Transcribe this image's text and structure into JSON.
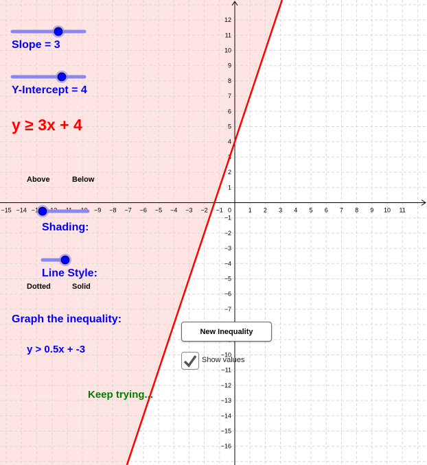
{
  "graph": {
    "x_range": [
      -15,
      11
    ],
    "y_range": [
      -16,
      12
    ],
    "line": {
      "slope": 3,
      "intercept": 4,
      "shade": "above",
      "style": "solid"
    },
    "colors": {
      "line": "#ff0000",
      "shade": "#ffe4e4",
      "grid": "#d8d8d8",
      "slider": "#0000ff",
      "feedback": "#008000"
    }
  },
  "controls": {
    "slope_label": "Slope = 3",
    "slope_value": 3,
    "intercept_label": "Y-Intercept = 4",
    "intercept_value": 4,
    "inequality": "y ≥ 3x + 4",
    "above_label": "Above",
    "below_label": "Below",
    "shading_label": "Shading:",
    "line_style_label": "Line Style:",
    "dotted_label": "Dotted",
    "solid_label": "Solid",
    "task_label": "Graph the inequality:",
    "target_inequality": "y > 0.5x + -3",
    "feedback": "Keep trying...",
    "new_button": "New Inequality",
    "show_values_label": "Show values",
    "show_values_checked": true
  }
}
